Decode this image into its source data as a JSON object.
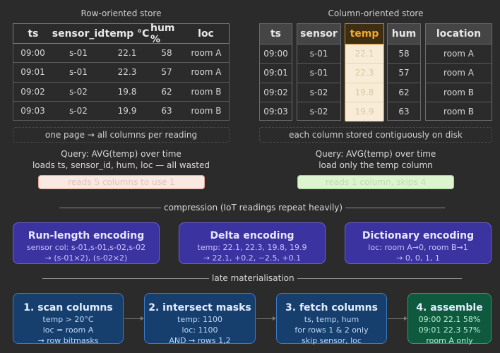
{
  "row_store": {
    "title": "Row-oriented store",
    "headers": [
      "ts",
      "sensor_id",
      "temp °C",
      "hum %",
      "loc"
    ],
    "rows": [
      [
        "09:00",
        "s-01",
        "22.1",
        "58",
        "room A"
      ],
      [
        "09:01",
        "s-01",
        "22.3",
        "57",
        "room A"
      ],
      [
        "09:02",
        "s-02",
        "19.8",
        "62",
        "room B"
      ],
      [
        "09:03",
        "s-02",
        "19.9",
        "63",
        "room B"
      ]
    ],
    "caption": "one page → all columns per reading",
    "query_line1": "Query: AVG(temp) over time",
    "query_line2": "loads ts, sensor_id, hum, loc — all wasted",
    "result": "reads 5 columns to use 1"
  },
  "column_store": {
    "title": "Column-oriented store",
    "headers": [
      "ts",
      "sensor",
      "temp",
      "hum",
      "location"
    ],
    "columns": [
      [
        "09:00",
        "09:01",
        "09:02",
        "09:03"
      ],
      [
        "s-01",
        "s-01",
        "s-02",
        "s-02"
      ],
      [
        "22.1",
        "22.3",
        "19.8",
        "19.9"
      ],
      [
        "58",
        "57",
        "62",
        "63"
      ],
      [
        "room A",
        "room A",
        "room B",
        "room B"
      ]
    ],
    "caption": "each column stored contiguously on disk",
    "query_line1": "Query: AVG(temp) over time",
    "query_line2": "load only the temp column",
    "result": "reads 1 column, skips 4"
  },
  "compression": {
    "heading": "compression (IoT readings repeat heavily)",
    "cards": [
      {
        "title": "Run-length encoding",
        "line1": "sensor col: s-01,s-01,s-02,s-02",
        "line2": "→ (s-01×2), (s-02×2)"
      },
      {
        "title": "Delta encoding",
        "line1": "temp: 22.1, 22.3, 19.8, 19.9",
        "line2": "→ 22.1, +0.2, −2.5, +0.1"
      },
      {
        "title": "Dictionary encoding",
        "line1": "loc: room A→0, room B→1",
        "line2": "→ 0, 0, 1, 1"
      }
    ]
  },
  "late": {
    "heading": "late materialisation",
    "steps": [
      {
        "title": "1. scan columns",
        "line1": "temp > 20°C",
        "line2": "loc = room A",
        "line3": "→ row bitmasks"
      },
      {
        "title": "2. intersect masks",
        "line1": "temp: 1100",
        "line2": "loc: 1100",
        "line3": "AND → rows 1,2"
      },
      {
        "title": "3. fetch columns",
        "line1": "ts, temp, hum",
        "line2": "for rows 1 & 2 only",
        "line3": "skip sensor, loc"
      },
      {
        "title": "4. assemble",
        "line1": "09:00 22.1 58%",
        "line2": "09:01 22.3 57%",
        "line3": "room A only"
      }
    ]
  },
  "colors": {
    "temp_highlight": "#c98a1a",
    "row_result": "#f8e6e0",
    "col_result": "#d8f3c8",
    "encoding": "#3b33a0",
    "step": "#173f6e",
    "assemble": "#0f5a3e"
  }
}
